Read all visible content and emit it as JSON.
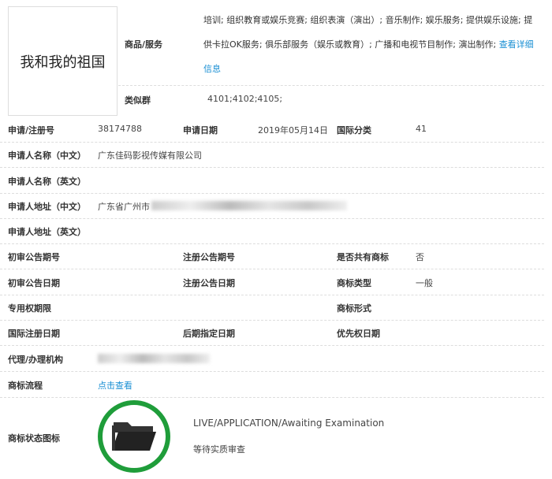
{
  "trademark": {
    "name": "我和我的祖国"
  },
  "goods": {
    "label": "商品/服务",
    "text": "培训; 组织教育或娱乐竞赛; 组织表演（演出）; 音乐制作; 娱乐服务; 提供娱乐设施; 提供卡拉OK服务; 俱乐部服务（娱乐或教育）; 广播和电视节目制作; 演出制作; ",
    "link": "查看详细信息"
  },
  "similar": {
    "label": "类似群",
    "value": "4101;4102;4105;"
  },
  "rows": [
    {
      "l1": "申请/注册号",
      "v1": "38174788",
      "l2": "申请日期",
      "v2": "2019年05月14日",
      "l3": "国际分类",
      "v3": "41"
    },
    {
      "l1": "申请人名称（中文）",
      "v1": "广东佳码影视传媒有限公司"
    },
    {
      "l1": "申请人名称（英文）"
    },
    {
      "l1": "申请人地址（中文）",
      "v1": "广东省广州市"
    },
    {
      "l1": "申请人地址（英文）"
    },
    {
      "l1": "初审公告期号",
      "l2": "注册公告期号",
      "l3": "是否共有商标",
      "v3": "否"
    },
    {
      "l1": "初审公告日期",
      "l2": "注册公告日期",
      "l3": "商标类型",
      "v3": "一般"
    },
    {
      "l1": "专用权期限",
      "l3": "商标形式"
    },
    {
      "l1": "国际注册日期",
      "l2": "后期指定日期",
      "l3": "优先权日期"
    },
    {
      "l1": "代理/办理机构"
    },
    {
      "l1": "商标流程",
      "link": "点击查看"
    }
  ],
  "status": {
    "label": "商标状态图标",
    "en": "LIVE/APPLICATION/Awaiting Examination",
    "zh": "等待实质审查",
    "icon": "folder-icon",
    "ring_color": "#1f9d3a"
  }
}
